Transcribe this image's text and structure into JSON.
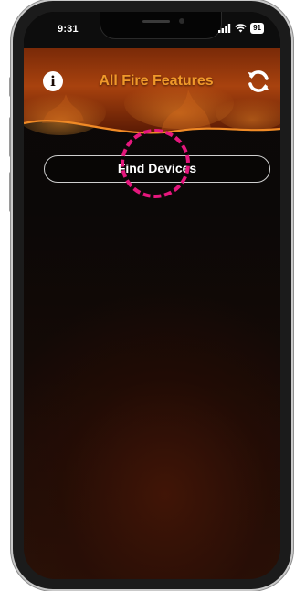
{
  "status_bar": {
    "time": "9:31",
    "battery": "91",
    "signal_icon": "signal-bars-icon",
    "wifi_icon": "wifi-icon"
  },
  "header": {
    "title": "All Fire Features",
    "info_icon": "info-icon",
    "info_glyph": "i",
    "refresh_icon": "refresh-icon"
  },
  "main": {
    "find_devices_label": "Find Devices"
  },
  "colors": {
    "title": "#f0992a",
    "background": "#0c0908",
    "flame_orange": "#e8801c",
    "tap_indicator": "#e5177d"
  }
}
